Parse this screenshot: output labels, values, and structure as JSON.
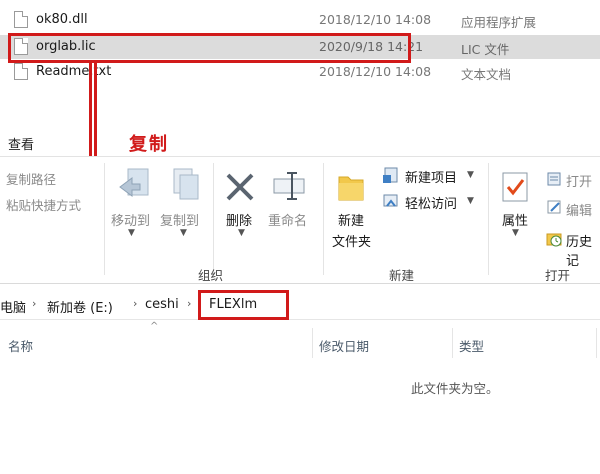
{
  "files": [
    {
      "name": "ok80.dll",
      "date": "2018/12/10 14:08",
      "type": "应用程序扩展"
    },
    {
      "name": "orglab.lic",
      "date": "2020/9/18 14:21",
      "type": "LIC 文件"
    },
    {
      "name": "Readme.txt",
      "date": "2018/12/10 14:08",
      "type": "文本文档"
    }
  ],
  "annotation": {
    "copy_label": "复制",
    "color": "#d11a1a"
  },
  "ribbon": {
    "tab_label": "查看",
    "copy_path": "复制路径",
    "paste_shortcut": "粘贴快捷方式",
    "move_to": "移动到",
    "copy_to": "复制到",
    "delete": "删除",
    "rename": "重命名",
    "new_folder_line1": "新建",
    "new_folder_line2": "文件夹",
    "new_item": "新建项目",
    "easy_access": "轻松访问",
    "properties": "属性",
    "open": "打开",
    "edit": "编辑",
    "history": "历史记",
    "group_organize": "组织",
    "group_new": "新建",
    "group_open": "打开"
  },
  "address": {
    "crumbs": [
      "电脑",
      "新加卷 (E:)",
      "ceshi",
      "FLEXlm"
    ]
  },
  "columns": {
    "name": "名称",
    "modified": "修改日期",
    "type": "类型"
  },
  "empty_message": "此文件夹为空。"
}
